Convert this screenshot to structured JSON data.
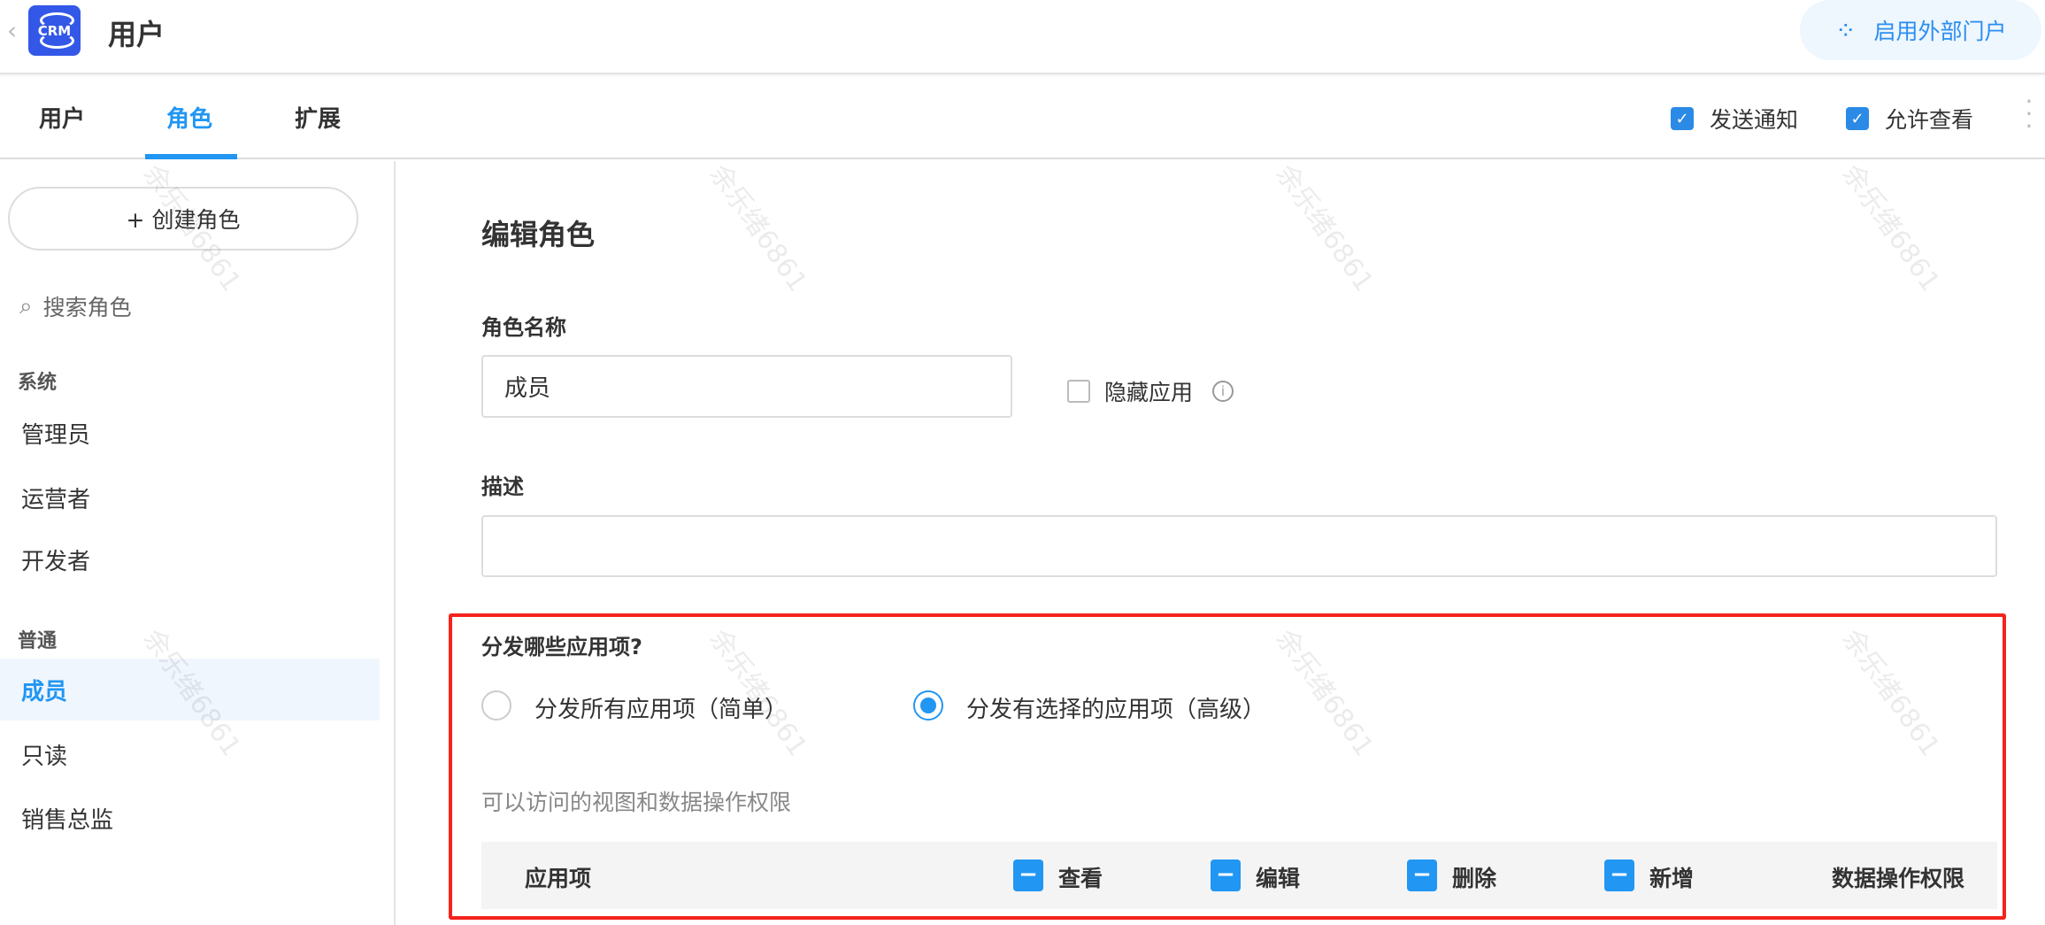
{
  "header": {
    "title": "用户",
    "logo_text": "CRM",
    "portal_button": "启用外部门户"
  },
  "tabs": [
    {
      "label": "用户"
    },
    {
      "label": "角色"
    },
    {
      "label": "扩展"
    }
  ],
  "toolbar": {
    "send_notice": "发送通知",
    "allow_view": "允许查看"
  },
  "sidebar": {
    "create_button": "+ 创建角色",
    "search_placeholder": "搜索角色",
    "groups": [
      {
        "label": "系统",
        "items": [
          "管理员",
          "运营者",
          "开发者"
        ]
      },
      {
        "label": "普通",
        "items": [
          "成员",
          "只读",
          "销售总监"
        ]
      }
    ],
    "selected": "成员"
  },
  "form": {
    "title": "编辑角色",
    "name_label": "角色名称",
    "name_value": "成员",
    "hide_app_label": "隐藏应用",
    "desc_label": "描述",
    "desc_value": "",
    "distribute_label": "分发哪些应用项?",
    "option_all": "分发所有应用项（简单）",
    "option_selected": "分发有选择的应用项（高级）",
    "selected_option": "option_selected",
    "permissions_hint": "可以访问的视图和数据操作权限",
    "table_headers": {
      "app": "应用项",
      "view": "查看",
      "edit": "编辑",
      "delete": "删除",
      "add": "新增",
      "data_perm": "数据操作权限"
    }
  },
  "watermark": "余乐绪6861",
  "colors": {
    "accent": "#2196f3",
    "logo": "#3358e8",
    "highlight": "#f5231d"
  }
}
